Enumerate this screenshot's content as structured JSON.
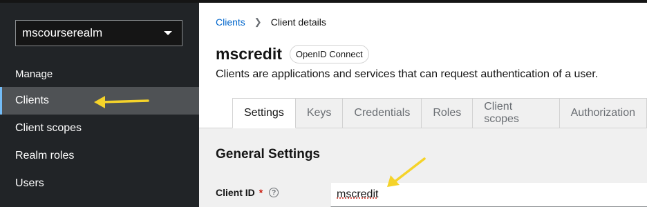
{
  "sidebar": {
    "realm": "mscourserealm",
    "section_heading": "Manage",
    "items": [
      {
        "label": "Clients"
      },
      {
        "label": "Client scopes"
      },
      {
        "label": "Realm roles"
      },
      {
        "label": "Users"
      }
    ]
  },
  "breadcrumb": {
    "parent": "Clients",
    "current": "Client details"
  },
  "header": {
    "title": "mscredit",
    "badge": "OpenID Connect",
    "description": "Clients are applications and services that can request authentication of a user."
  },
  "tabs": [
    {
      "label": "Settings"
    },
    {
      "label": "Keys"
    },
    {
      "label": "Credentials"
    },
    {
      "label": "Roles"
    },
    {
      "label": "Client scopes"
    },
    {
      "label": "Authorization"
    }
  ],
  "settings": {
    "section_title": "General Settings",
    "client_id_label": "Client ID",
    "required_mark": "*",
    "help_glyph": "?",
    "client_id_value": "mscredit"
  },
  "colors": {
    "sidebar_bg": "#212427",
    "active_item_bg": "#4f5255",
    "active_indicator": "#73bcf7",
    "link": "#0066cc",
    "annotation_arrow": "#f5d32a",
    "required": "#c9190b"
  },
  "icons": [
    "chevron-down-icon",
    "breadcrumb-separator-icon",
    "help-icon",
    "annotation-arrow-icon"
  ]
}
